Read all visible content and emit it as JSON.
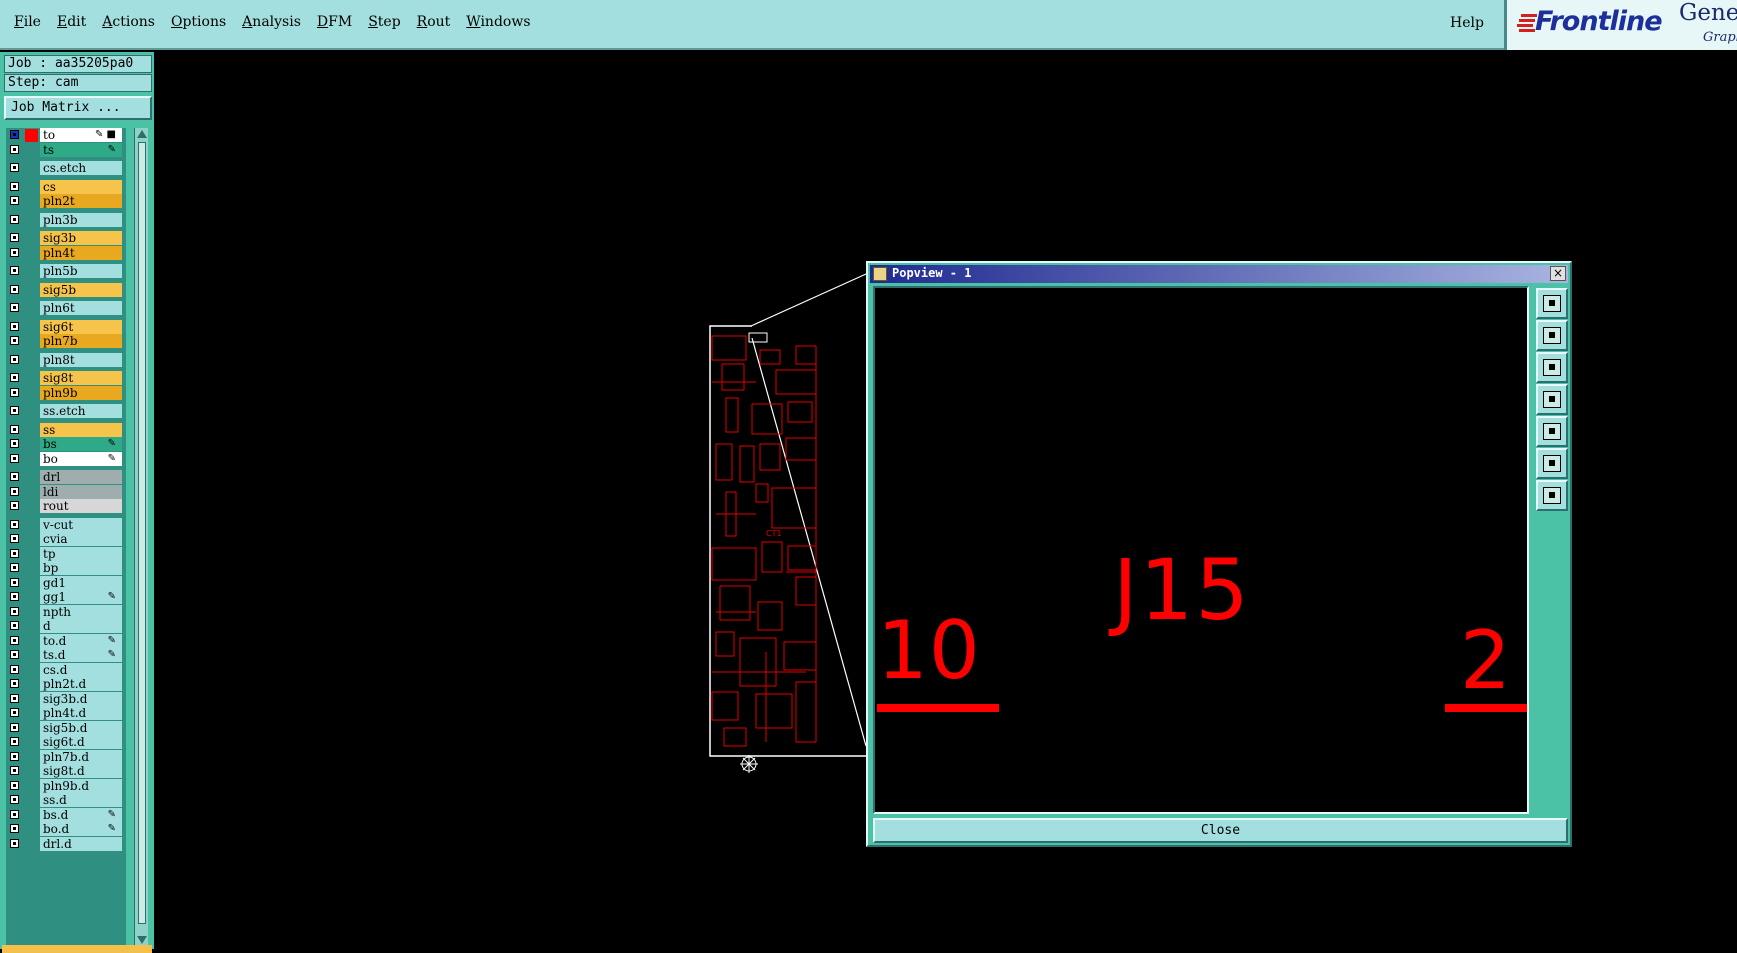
{
  "menubar": {
    "items": [
      "File",
      "Edit",
      "Actions",
      "Options",
      "Analysis",
      "DFM",
      "Step",
      "Rout",
      "Windows"
    ],
    "help": "Help",
    "logo": {
      "brand": "Frontline",
      "product": "Genes",
      "sub": "Graph"
    }
  },
  "job_panel": {
    "job": "Job : aa35205pa0",
    "step": "Step: cam",
    "matrix_button": "Job Matrix ..."
  },
  "layers": [
    {
      "name": "to",
      "color": "#ffffff",
      "flag": "✎ ■",
      "active": true
    },
    {
      "name": "ts",
      "color": "#2eab86",
      "flag": "✎"
    },
    {
      "name": "cs.etch",
      "color": "#a3dfdf",
      "flag": ""
    },
    {
      "name": "cs",
      "color": "#f6c44a",
      "flag": ""
    },
    {
      "name": "pln2t",
      "color": "#e8a920",
      "flag": ""
    },
    {
      "name": "pln3b",
      "color": "#a3dfdf",
      "flag": ""
    },
    {
      "name": "sig3b",
      "color": "#f6c44a",
      "flag": ""
    },
    {
      "name": "pln4t",
      "color": "#e8a920",
      "flag": ""
    },
    {
      "name": "pln5b",
      "color": "#a3dfdf",
      "flag": ""
    },
    {
      "name": "sig5b",
      "color": "#f6c44a",
      "flag": ""
    },
    {
      "name": "pln6t",
      "color": "#a3dfdf",
      "flag": ""
    },
    {
      "name": "sig6t",
      "color": "#f6c44a",
      "flag": ""
    },
    {
      "name": "pln7b",
      "color": "#e8a920",
      "flag": ""
    },
    {
      "name": "pln8t",
      "color": "#a3dfdf",
      "flag": ""
    },
    {
      "name": "sig8t",
      "color": "#f6c44a",
      "flag": ""
    },
    {
      "name": "pln9b",
      "color": "#e8a920",
      "flag": ""
    },
    {
      "name": "ss.etch",
      "color": "#a3dfdf",
      "flag": ""
    },
    {
      "name": "ss",
      "color": "#f6c44a",
      "flag": ""
    },
    {
      "name": "bs",
      "color": "#2eab86",
      "flag": "✎"
    },
    {
      "name": "bo",
      "color": "#ffffff",
      "flag": "✎"
    },
    {
      "name": "drl",
      "color": "#9fadae",
      "flag": ""
    },
    {
      "name": "ldi",
      "color": "#9fadae",
      "flag": ""
    },
    {
      "name": "rout",
      "color": "#d7d7d7",
      "flag": ""
    },
    {
      "name": "v-cut",
      "color": "#a3dfdf",
      "flag": ""
    },
    {
      "name": "cvia",
      "color": "#a3dfdf",
      "flag": ""
    },
    {
      "name": "tp",
      "color": "#a3dfdf",
      "flag": ""
    },
    {
      "name": "bp",
      "color": "#a3dfdf",
      "flag": ""
    },
    {
      "name": "gd1",
      "color": "#a3dfdf",
      "flag": ""
    },
    {
      "name": "gg1",
      "color": "#a3dfdf",
      "flag": "✎"
    },
    {
      "name": "npth",
      "color": "#a3dfdf",
      "flag": ""
    },
    {
      "name": "d",
      "color": "#a3dfdf",
      "flag": ""
    },
    {
      "name": "to.d",
      "color": "#a3dfdf",
      "flag": "✎"
    },
    {
      "name": "ts.d",
      "color": "#a3dfdf",
      "flag": "✎"
    },
    {
      "name": "cs.d",
      "color": "#a3dfdf",
      "flag": ""
    },
    {
      "name": "pln2t.d",
      "color": "#a3dfdf",
      "flag": ""
    },
    {
      "name": "sig3b.d",
      "color": "#a3dfdf",
      "flag": ""
    },
    {
      "name": "pln4t.d",
      "color": "#a3dfdf",
      "flag": ""
    },
    {
      "name": "sig5b.d",
      "color": "#a3dfdf",
      "flag": ""
    },
    {
      "name": "sig6t.d",
      "color": "#a3dfdf",
      "flag": ""
    },
    {
      "name": "pln7b.d",
      "color": "#a3dfdf",
      "flag": ""
    },
    {
      "name": "sig8t.d",
      "color": "#a3dfdf",
      "flag": ""
    },
    {
      "name": "pln9b.d",
      "color": "#a3dfdf",
      "flag": ""
    },
    {
      "name": "ss.d",
      "color": "#a3dfdf",
      "flag": ""
    },
    {
      "name": "bs.d",
      "color": "#a3dfdf",
      "flag": "✎"
    },
    {
      "name": "bo.d",
      "color": "#a3dfdf",
      "flag": "✎"
    },
    {
      "name": "drl.d",
      "color": "#a3dfdf",
      "flag": ""
    }
  ],
  "popview": {
    "title": "Popview - 1",
    "close_x": "×",
    "close_button": "Close",
    "tool_icons": [
      "window-select-icon",
      "pan-up-icon",
      "pan-down-icon",
      "pan-left-icon",
      "pan-right-icon",
      "zoom-fit-icon",
      "zoom-home-icon"
    ],
    "labels": {
      "refdes": "J15",
      "pin_left": "10",
      "pin_right": "2"
    }
  },
  "colors": {
    "panel_bg": "#4bc1a6",
    "menubar_bg": "#a3dfdf",
    "feature": "#ff0000",
    "titlebar": "#1f2a90"
  }
}
